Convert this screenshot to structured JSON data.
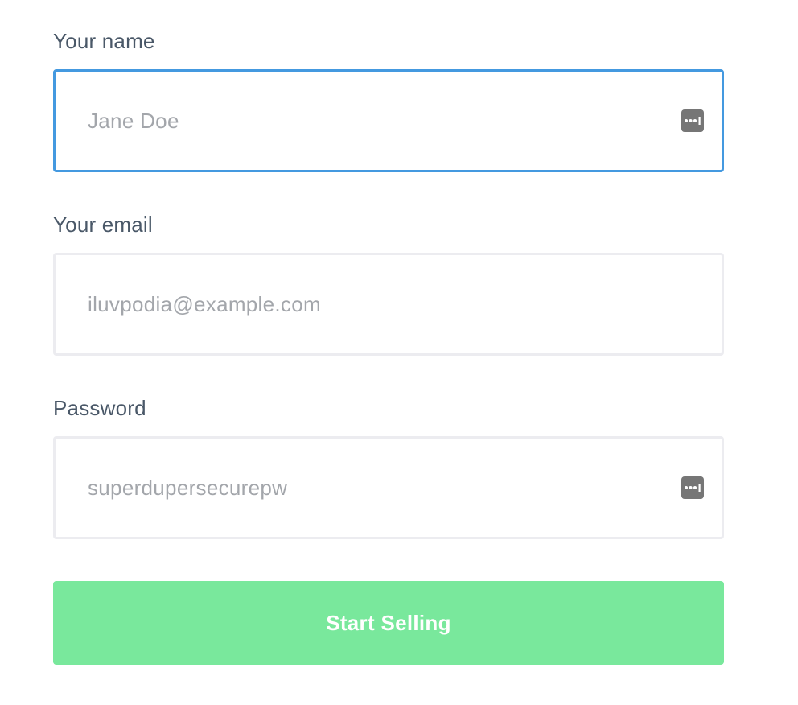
{
  "form": {
    "name": {
      "label": "Your name",
      "placeholder": "Jane Doe",
      "focused": true,
      "icon": "password-manager-icon"
    },
    "email": {
      "label": "Your email",
      "placeholder": "iluvpodia@example.com",
      "focused": false
    },
    "password": {
      "label": "Password",
      "placeholder": "superdupersecurepw",
      "focused": false,
      "icon": "password-manager-icon"
    },
    "submit_label": "Start Selling"
  },
  "colors": {
    "focus_border": "#4499e0",
    "field_border": "#ececf0",
    "label_text": "#4a5868",
    "placeholder_text": "#a3a6ab",
    "button_bg": "#79e89c",
    "button_text": "#ffffff"
  }
}
